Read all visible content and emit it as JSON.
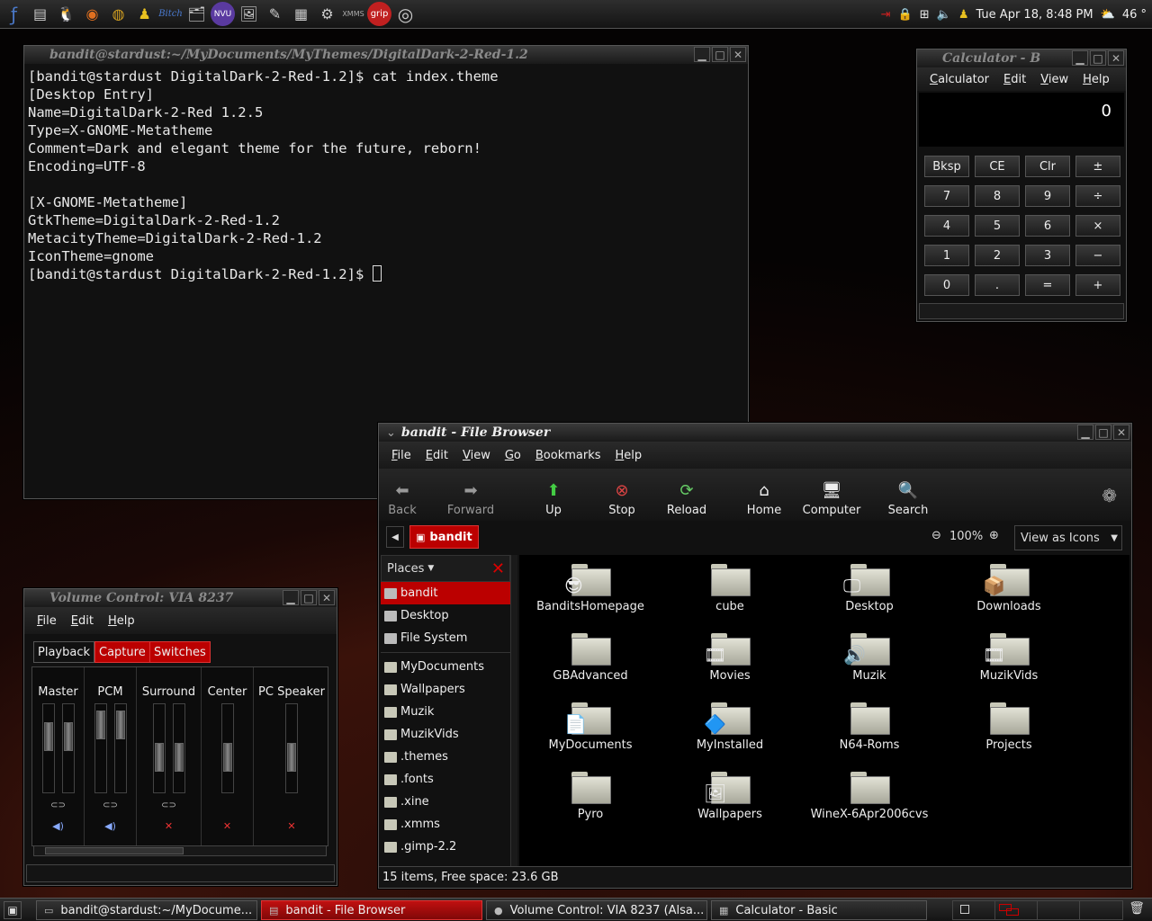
{
  "top_panel": {
    "launchers": [
      "fedora-icon",
      "files-icon",
      "tux-icon",
      "firefox-icon",
      "globe-icon",
      "tux-yellow-icon",
      "bitch-icon",
      "fm-icon",
      "nvu-icon",
      "image-icon",
      "editor-icon",
      "spreadsheet-icon",
      "network-icon",
      "xmms-icon",
      "grip-icon",
      "cd-icon"
    ],
    "launcher_labels": {
      "bitch": "Bitch",
      "nvu": "NVU",
      "xmms": "XMMS",
      "grip": "grip"
    },
    "clock": "Tue Apr 18,  8:48 PM",
    "weather": "46 °"
  },
  "terminal": {
    "title": "bandit@stardust:~/MyDocuments/MyThemes/DigitalDark-2-Red-1.2",
    "lines": [
      "[bandit@stardust DigitalDark-2-Red-1.2]$ cat index.theme",
      "[Desktop Entry]",
      "Name=DigitalDark-2-Red 1.2.5",
      "Type=X-GNOME-Metatheme",
      "Comment=Dark and elegant theme for the future, reborn!",
      "Encoding=UTF-8",
      "",
      "[X-GNOME-Metatheme]",
      "GtkTheme=DigitalDark-2-Red-1.2",
      "MetacityTheme=DigitalDark-2-Red-1.2",
      "IconTheme=gnome",
      "[bandit@stardust DigitalDark-2-Red-1.2]$ "
    ]
  },
  "calculator": {
    "title": "Calculator - B",
    "menu": [
      "Calculator",
      "Edit",
      "View",
      "Help"
    ],
    "display": "0",
    "buttons": [
      [
        "Bksp",
        "CE",
        "Clr",
        "±"
      ],
      [
        "7",
        "8",
        "9",
        "÷"
      ],
      [
        "4",
        "5",
        "6",
        "×"
      ],
      [
        "1",
        "2",
        "3",
        "−"
      ],
      [
        "0",
        ".",
        "=",
        "+"
      ]
    ]
  },
  "file_browser": {
    "title": "bandit - File Browser",
    "menu": [
      "File",
      "Edit",
      "View",
      "Go",
      "Bookmarks",
      "Help"
    ],
    "toolbar": [
      "Back",
      "Forward",
      "Up",
      "Stop",
      "Reload",
      "Home",
      "Computer",
      "Search"
    ],
    "location": "bandit",
    "zoom": "100%",
    "view_mode": "View as Icons",
    "sidebar_title": "Places",
    "places": [
      "bandit",
      "Desktop",
      "File System"
    ],
    "bookmarks": [
      "MyDocuments",
      "Wallpapers",
      "Muzik",
      "MuzikVids",
      ".themes",
      ".fonts",
      ".xine",
      ".xmms",
      ".gimp-2.2"
    ],
    "items": [
      {
        "name": "BanditsHomepage",
        "badge": "😎"
      },
      {
        "name": "cube",
        "badge": ""
      },
      {
        "name": "Desktop",
        "badge": "🖵"
      },
      {
        "name": "Downloads",
        "badge": "📦"
      },
      {
        "name": "GBAdvanced",
        "badge": ""
      },
      {
        "name": "Movies",
        "badge": "🎞"
      },
      {
        "name": "Muzik",
        "badge": "🔊"
      },
      {
        "name": "MuzikVids",
        "badge": "🎞"
      },
      {
        "name": "MyDocuments",
        "badge": "📄"
      },
      {
        "name": "MyInstalled",
        "badge": "🔷"
      },
      {
        "name": "N64-Roms",
        "badge": ""
      },
      {
        "name": "Projects",
        "badge": ""
      },
      {
        "name": "Pyro",
        "badge": ""
      },
      {
        "name": "Wallpapers",
        "badge": "🖼"
      },
      {
        "name": "WineX-6Apr2006cvs",
        "badge": ""
      }
    ],
    "status": "15 items, Free space: 23.6 GB"
  },
  "volume": {
    "title": "Volume Control: VIA 8237",
    "menu": [
      "File",
      "Edit",
      "Help"
    ],
    "tabs": [
      "Playback",
      "Capture",
      "Switches"
    ],
    "channels": [
      "Master",
      "PCM",
      "Surround",
      "Center",
      "PC Speaker"
    ]
  },
  "taskbar": [
    {
      "label": "bandit@stardust:~/MyDocume...",
      "active": false
    },
    {
      "label": "bandit - File Browser",
      "active": true
    },
    {
      "label": "Volume Control: VIA 8237 (Alsa...",
      "active": false
    },
    {
      "label": "Calculator  - Basic",
      "active": false
    }
  ]
}
